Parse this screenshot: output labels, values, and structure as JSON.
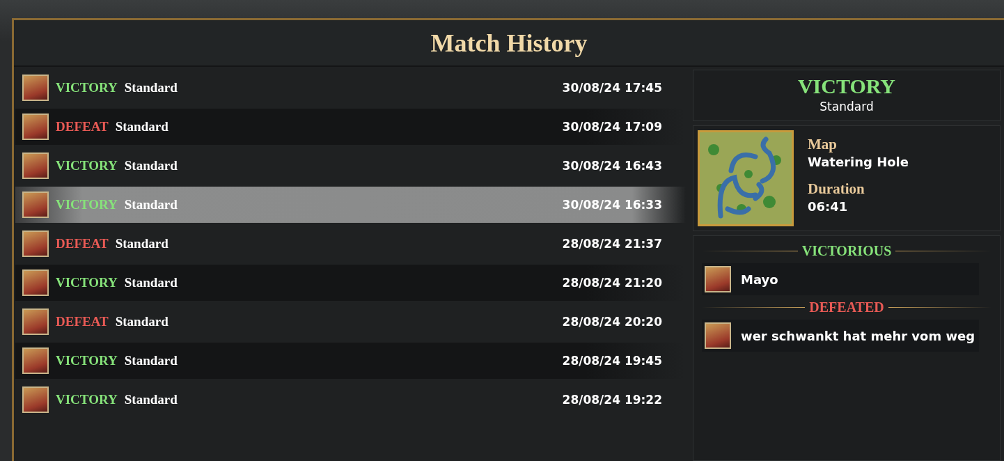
{
  "window": {
    "title": "Match History"
  },
  "matches": [
    {
      "result": "VICTORY",
      "kind": "victory",
      "mode": "Standard",
      "time": "30/08/24 17:45",
      "selected": false
    },
    {
      "result": "DEFEAT",
      "kind": "defeat",
      "mode": "Standard",
      "time": "30/08/24 17:09",
      "selected": false
    },
    {
      "result": "VICTORY",
      "kind": "victory",
      "mode": "Standard",
      "time": "30/08/24 16:43",
      "selected": false
    },
    {
      "result": "VICTORY",
      "kind": "victory",
      "mode": "Standard",
      "time": "30/08/24 16:33",
      "selected": true
    },
    {
      "result": "DEFEAT",
      "kind": "defeat",
      "mode": "Standard",
      "time": "28/08/24 21:37",
      "selected": false
    },
    {
      "result": "VICTORY",
      "kind": "victory",
      "mode": "Standard",
      "time": "28/08/24 21:20",
      "selected": false
    },
    {
      "result": "DEFEAT",
      "kind": "defeat",
      "mode": "Standard",
      "time": "28/08/24 20:20",
      "selected": false
    },
    {
      "result": "VICTORY",
      "kind": "victory",
      "mode": "Standard",
      "time": "28/08/24 19:45",
      "selected": false
    },
    {
      "result": "VICTORY",
      "kind": "victory",
      "mode": "Standard",
      "time": "28/08/24 19:22",
      "selected": false
    }
  ],
  "detail": {
    "result": "VICTORY",
    "kind": "victory",
    "mode": "Standard",
    "map_label": "Map",
    "map": "Watering Hole",
    "duration_label": "Duration",
    "duration": "06:41",
    "teams": [
      {
        "title": "VICTORIOUS",
        "kind": "victory",
        "players": [
          "Mayo"
        ]
      },
      {
        "title": "DEFEATED",
        "kind": "defeat",
        "players": [
          "wer schwankt hat mehr vom weg"
        ]
      }
    ]
  }
}
